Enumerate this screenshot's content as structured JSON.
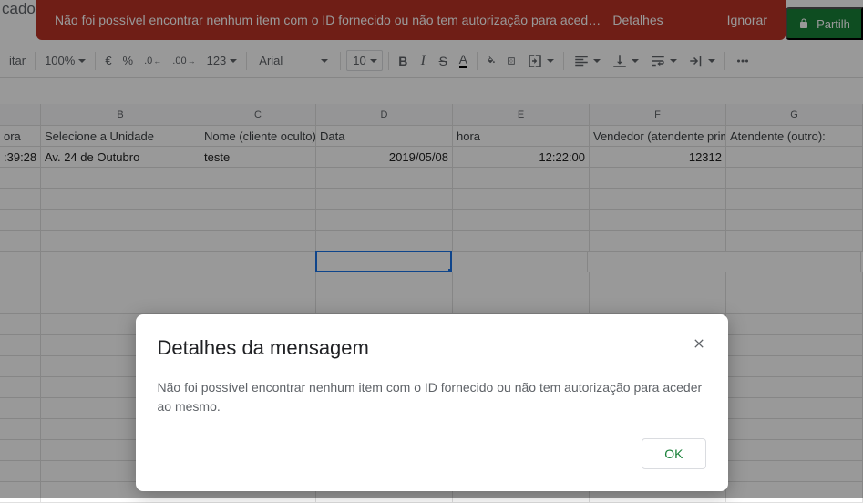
{
  "title_partial": "cado - BASIC  (Respostas)",
  "error_banner": {
    "message": "Não foi possível encontrar nenhum item com o ID fornecido ou não tem autorização para aced…",
    "details": "Detalhes",
    "ignore": "Ignorar"
  },
  "share": {
    "label": "Partilh"
  },
  "toolbar": {
    "edit_label": "itar",
    "zoom": "100%",
    "currency": "€",
    "percent": "%",
    "dec_dec": ".0",
    "dec_inc": ".00",
    "num_format": "123",
    "font": "Arial",
    "size": "10",
    "bold": "B",
    "italic": "I",
    "strike": "S",
    "textcolor": "A"
  },
  "columns": {
    "b": "B",
    "c": "C",
    "d": "D",
    "e": "E",
    "f": "F",
    "g": "G"
  },
  "header_row": {
    "a": "ora",
    "b": "Selecione a Unidade",
    "c": "Nome (cliente oculto)",
    "d": "Data",
    "e": "hora",
    "f": "Vendedor (atendente prin",
    "g": "Atendente (outro):"
  },
  "data_row": {
    "a": ":39:28",
    "b": "Av. 24 de Outubro",
    "c": "teste",
    "d": "2019/05/08",
    "e": "12:22:00",
    "f": "12312",
    "g": ""
  },
  "dialog": {
    "title": "Detalhes da mensagem",
    "body": "Não foi possível encontrar nenhum item com o ID fornecido ou não tem autorização para aceder ao mesmo.",
    "ok": "OK"
  }
}
